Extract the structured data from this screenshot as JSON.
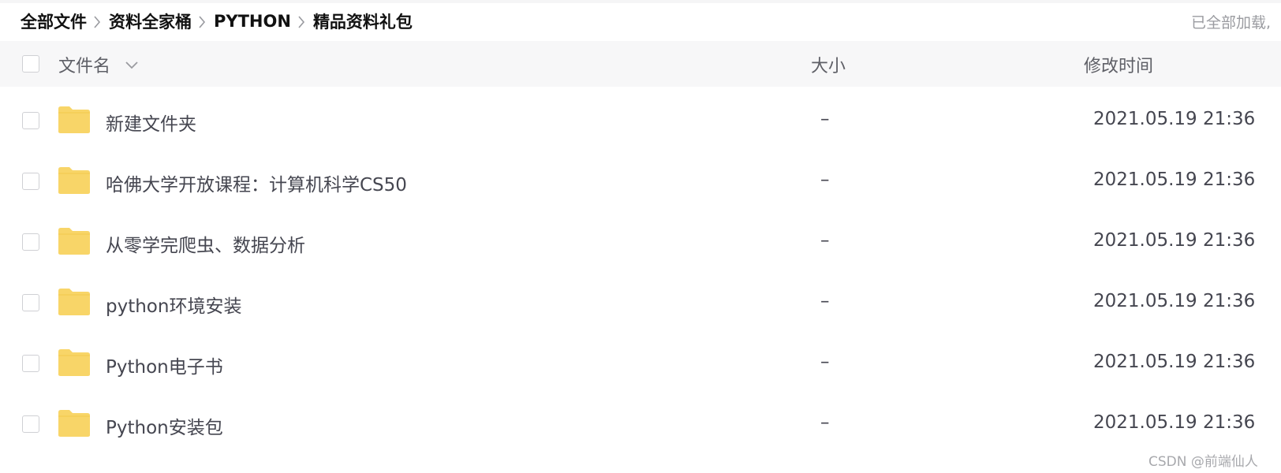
{
  "breadcrumb": {
    "items": [
      "全部文件",
      "资料全家桶",
      "PYTHON",
      "精品资料礼包"
    ]
  },
  "status": {
    "loaded_text": "已全部加载,"
  },
  "list_header": {
    "name_label": "文件名",
    "size_label": "大小",
    "time_label": "修改时间",
    "sort_icon": "chevron-down-icon"
  },
  "files": [
    {
      "name": "新建文件夹",
      "size": "–",
      "modified": "2021.05.19 21:36",
      "icon": "folder-icon"
    },
    {
      "name": "哈佛大学开放课程：计算机科学CS50",
      "size": "–",
      "modified": "2021.05.19 21:36",
      "icon": "folder-icon"
    },
    {
      "name": "从零学完爬虫、数据分析",
      "size": "–",
      "modified": "2021.05.19 21:36",
      "icon": "folder-icon"
    },
    {
      "name": "python环境安装",
      "size": "–",
      "modified": "2021.05.19 21:36",
      "icon": "folder-icon"
    },
    {
      "name": "Python电子书",
      "size": "–",
      "modified": "2021.05.19 21:36",
      "icon": "folder-icon"
    },
    {
      "name": "Python安装包",
      "size": "–",
      "modified": "2021.05.19 21:36",
      "icon": "folder-icon"
    }
  ],
  "watermark": "CSDN @前端仙人",
  "colors": {
    "folder": "#f8d568",
    "header_bg": "#f7f7f8",
    "checkbox_border": "#cfd0d4"
  }
}
